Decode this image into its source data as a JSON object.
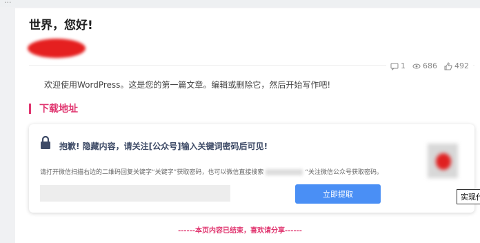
{
  "top_crumb": "...",
  "post": {
    "title": "世界，您好!",
    "comments": "1",
    "views": "686",
    "likes": "492",
    "intro": "欢迎使用WordPress。这是您的第一篇文章。编辑或删除它，然后开始写作吧!"
  },
  "download": {
    "section_title": "下载地址",
    "hide_title": "抱歉! 隐藏内容，请关注[公众号]输入关键词密码后可见!",
    "desc_part1": "请打开微信扫描右边的二维码回复关键字“关键字”获取密码，也可以微信直接搜索",
    "desc_part2": "“关注微信公众号获取密码。",
    "input_placeholder": "",
    "submit_label": "立即提取",
    "accent": "#4a8ff5"
  },
  "tooltip": "实现代码",
  "end_note": "------本页内容已结束，喜欢请分享------"
}
